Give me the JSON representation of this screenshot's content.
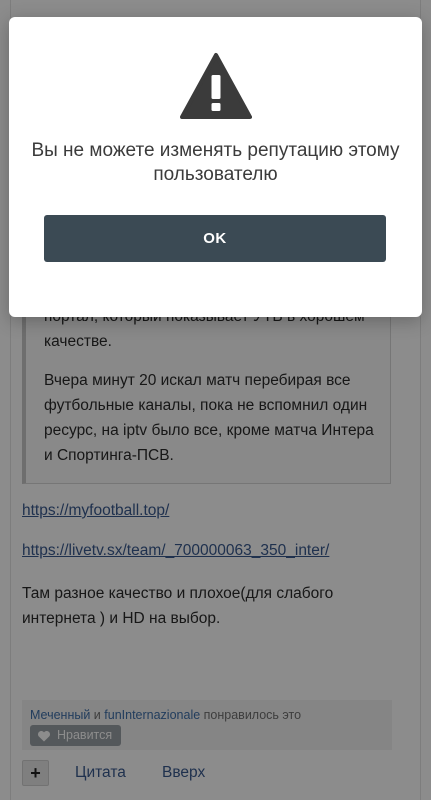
{
  "post": {
    "quote_paragraph_1": "портал, который показывает УТВ в хорошем качестве.",
    "quote_paragraph_2": "Вчера минут 20 искал матч перебирая все футбольные каналы, пока не вспомнил один ресурс, на iptv было все, кроме матча Интера и Спортинга-ПСВ.",
    "link_1": "https://myfootball.top/",
    "link_2": "https://livetv.sx/team/_700000063_350_inter/",
    "text": "Там разное качество и плохое(для слабого интернета ) и HD на выбор."
  },
  "likes": {
    "user_1": "Меченный",
    "conjunction": " и ",
    "user_2": "funInternazionale",
    "suffix": " понравилось это",
    "like_button_label": "Нравится",
    "like_icon": "heart-icon"
  },
  "actions": {
    "multiquote_label": "+",
    "quote_label": "Цитата",
    "top_label": "Вверх"
  },
  "modal": {
    "icon": "warning-icon",
    "message": "Вы не можете изменять репутацию этому пользователю",
    "ok_label": "OK"
  },
  "colors": {
    "overlay": "rgba(0,0,0,0.45)",
    "button_bg": "#3b4a54",
    "icon_color": "#3b3b3b",
    "link_color": "#3a5a8f"
  }
}
